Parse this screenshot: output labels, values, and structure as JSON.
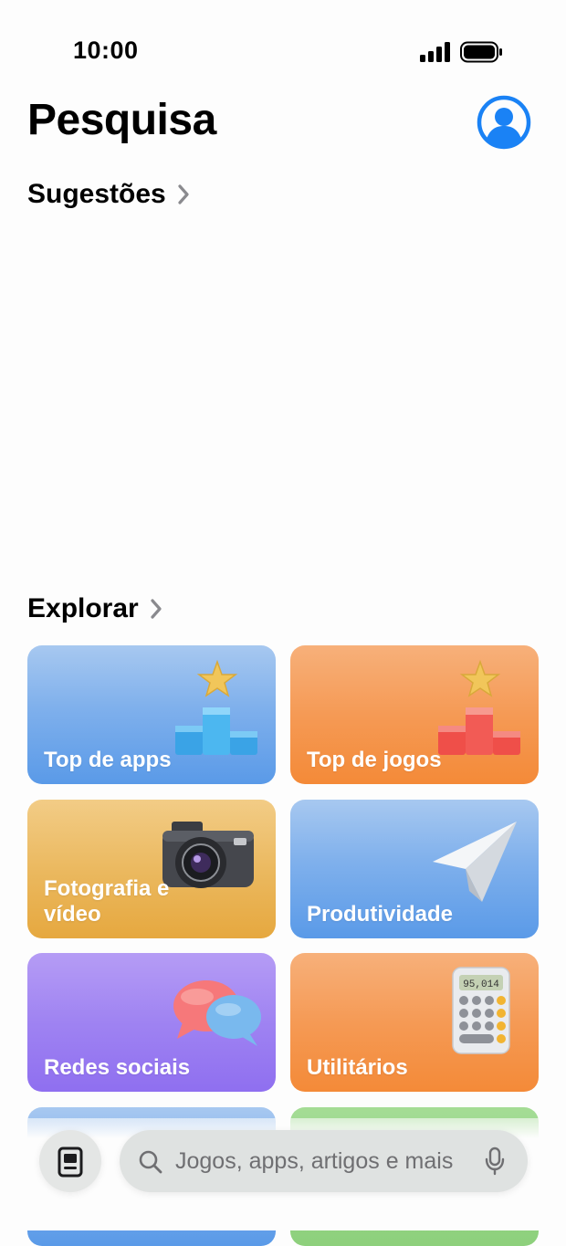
{
  "status_bar": {
    "time": "10:00"
  },
  "header": {
    "title": "Pesquisa"
  },
  "sections": {
    "suggestions": {
      "label": "Sugestões"
    },
    "explore": {
      "label": "Explorar"
    }
  },
  "categories": [
    {
      "label": "Top de apps",
      "icon": "podium-icon",
      "color": "blue"
    },
    {
      "label": "Top de jogos",
      "icon": "podium-icon",
      "color": "orange"
    },
    {
      "label": "Fotografia e vídeo",
      "icon": "camera-icon",
      "color": "gold"
    },
    {
      "label": "Produtividade",
      "icon": "paper-plane-icon",
      "color": "blue"
    },
    {
      "label": "Redes sociais",
      "icon": "chat-bubbles-icon",
      "color": "purple"
    },
    {
      "label": "Utilitários",
      "icon": "calculator-icon",
      "color": "orange",
      "display": "95,014"
    }
  ],
  "search": {
    "placeholder": "Jogos, apps, artigos e mais"
  },
  "colors": {
    "accent": "#1a82f5"
  }
}
